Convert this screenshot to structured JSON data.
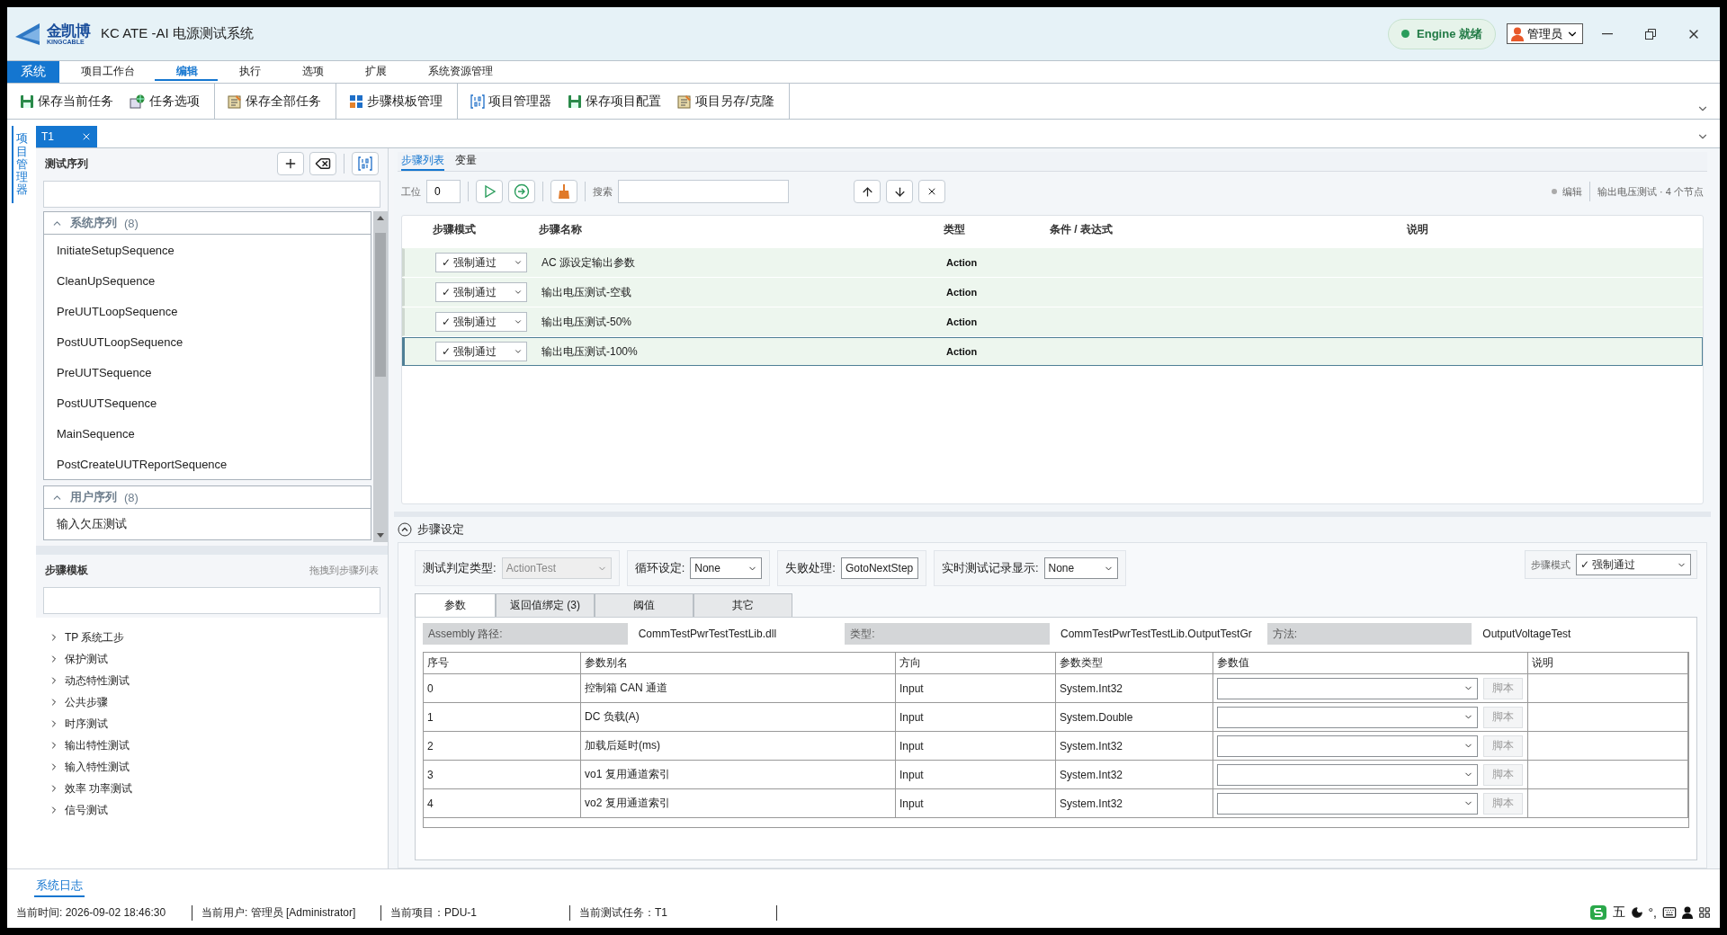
{
  "window": {
    "title": "KC ATE -AI 电源测试系统",
    "logo_text": "金凯博",
    "logo_subtext": "KINGCABLE"
  },
  "engine_status": {
    "label": "Engine 就绪"
  },
  "user_menu": {
    "label": "管理员"
  },
  "menu": [
    {
      "label": "系统",
      "kind": "app"
    },
    {
      "label": "项目工作台",
      "kind": "tab",
      "selected": false
    },
    {
      "label": "编辑",
      "kind": "tab",
      "selected": true
    },
    {
      "label": "执行",
      "kind": "tab",
      "selected": false
    },
    {
      "label": "选项",
      "kind": "tab",
      "selected": false
    },
    {
      "label": "扩展",
      "kind": "tab",
      "selected": false
    },
    {
      "label": "系统资源管理",
      "kind": "tab",
      "selected": false
    }
  ],
  "toolbar_groups": [
    [
      "保存当前任务",
      "任务选项"
    ],
    [
      "保存全部任务"
    ],
    [
      "步骤模板管理"
    ],
    [
      "项目管理器",
      "保存项目配置",
      "项目另存/克隆"
    ]
  ],
  "side_tab": {
    "label": "项目管理器",
    "selected": true
  },
  "doc_tabs": [
    {
      "label": "T1",
      "selected": true
    }
  ],
  "sequence_panel": {
    "title": "测试序列",
    "groups": [
      {
        "title": "系统序列",
        "count": "(8)",
        "expanded": true,
        "items": [
          "InitiateSetupSequence",
          "CleanUpSequence",
          "PreUUTLoopSequence",
          "PostUUTLoopSequence",
          "PreUUTSequence",
          "PostUUTSequence",
          "MainSequence",
          "PostCreateUUTReportSequence"
        ]
      },
      {
        "title": "用户序列",
        "count": "(8)",
        "expanded": true,
        "items": [
          "输入欠压测试"
        ]
      }
    ]
  },
  "template_panel": {
    "title": "步骤模板",
    "hint": "拖拽到步骤列表",
    "items": [
      {
        "label": "TP 系统工步",
        "expanded": false
      },
      {
        "label": "保护测试",
        "expanded": false
      },
      {
        "label": "动态特性测试",
        "expanded": false
      },
      {
        "label": "公共步骤",
        "expanded": false
      },
      {
        "label": "时序测试",
        "expanded": false
      },
      {
        "label": "输出特性测试",
        "expanded": false
      },
      {
        "label": "输入特性测试",
        "expanded": false
      },
      {
        "label": "效率 功率测试",
        "expanded": false
      },
      {
        "label": "信号测试",
        "expanded": false
      }
    ]
  },
  "step_tabs": [
    {
      "label": "步骤列表",
      "selected": true
    },
    {
      "label": "变量",
      "selected": false
    }
  ],
  "step_toolbar": {
    "station_label": "工位",
    "station_value": "0",
    "search_label": "搜索",
    "mode": "编辑",
    "context": "输出电压测试 · 4 个节点"
  },
  "step_table": {
    "columns": [
      "步骤模式",
      "步骤名称",
      "类型",
      "条件 / 表达式",
      "说明"
    ],
    "rows": [
      {
        "mode": "✓ 强制通过",
        "name": "AC 源设定输出参数",
        "type": "Action",
        "selected": false
      },
      {
        "mode": "✓ 强制通过",
        "name": "输出电压测试-空载",
        "type": "Action",
        "selected": false
      },
      {
        "mode": "✓ 强制通过",
        "name": "输出电压测试-50%",
        "type": "Action",
        "selected": false
      },
      {
        "mode": "✓ 强制通过",
        "name": "输出电压测试-100%",
        "type": "Action",
        "selected": true
      }
    ]
  },
  "step_settings": {
    "title": "步骤设定",
    "expanded": true,
    "fields": [
      {
        "label": "测试判定类型:",
        "value": "ActionTest",
        "disabled": true
      },
      {
        "label": "循环设定:",
        "value": "None",
        "disabled": false
      },
      {
        "label": "失败处理:",
        "value": "GotoNextStep",
        "disabled": false
      },
      {
        "label": "实时测试记录显示:",
        "value": "None",
        "disabled": false
      }
    ],
    "step_mode": {
      "label": "步骤模式",
      "value": "✓ 强制通过"
    },
    "tabs": [
      {
        "label": "参数",
        "selected": true
      },
      {
        "label": "返回值绑定 (3)",
        "selected": false
      },
      {
        "label": "阈值",
        "selected": false
      },
      {
        "label": "其它",
        "selected": false
      }
    ],
    "info": [
      {
        "label": "Assembly 路径:",
        "value": "CommTestPwrTestTestLib.dll"
      },
      {
        "label": "类型:",
        "value": "CommTestPwrTestTestLib.OutputTestGr"
      },
      {
        "label": "方法:",
        "value": "OutputVoltageTest"
      }
    ],
    "params": {
      "columns": [
        "序号",
        "参数别名",
        "方向",
        "参数类型",
        "参数值",
        "说明"
      ],
      "rows": [
        {
          "index": "0",
          "alias": "控制箱 CAN 通道",
          "direction": "Input",
          "type": "System.Int32",
          "button": "脚本",
          "disabled": true
        },
        {
          "index": "1",
          "alias": "DC 负载(A)",
          "direction": "Input",
          "type": "System.Double",
          "button": "脚本",
          "disabled": true
        },
        {
          "index": "2",
          "alias": "加载后延时(ms)",
          "direction": "Input",
          "type": "System.Int32",
          "button": "脚本",
          "disabled": true
        },
        {
          "index": "3",
          "alias": "vo1 复用通道索引",
          "direction": "Input",
          "type": "System.Int32",
          "button": "脚本",
          "disabled": true
        },
        {
          "index": "4",
          "alias": "vo2 复用通道索引",
          "direction": "Input",
          "type": "System.Int32",
          "button": "脚本",
          "disabled": true
        }
      ]
    }
  },
  "log_tabs": [
    {
      "label": "系统日志",
      "selected": true
    }
  ],
  "status_bar": [
    "当前时间: 2026-09-02 18:46:30",
    "当前用户: 管理员 [Administrator]",
    "当前项目：PDU-1",
    "当前测试任务：T1"
  ],
  "tray": {
    "ime_label": "五",
    "punct_label": "°,"
  }
}
